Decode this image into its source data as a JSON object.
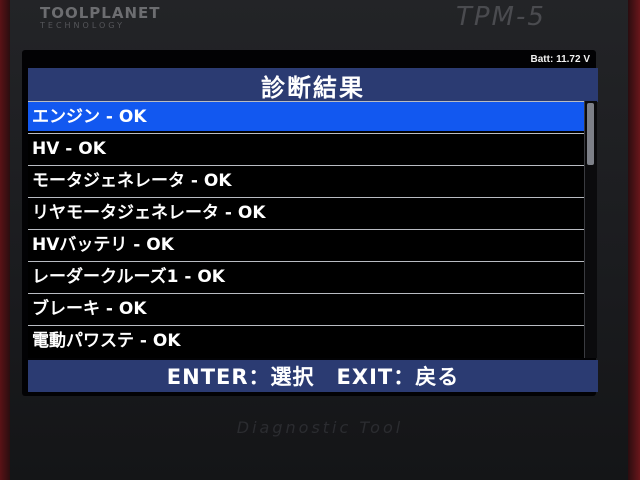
{
  "device": {
    "brand": "TOOLPLANET",
    "brand_sub": "TECHNOLOGY",
    "model": "TPM-5",
    "bottom_label": "Diagnostic Tool"
  },
  "status": {
    "battery": "Batt: 11.72 V"
  },
  "screen": {
    "title": "診断結果",
    "items": [
      {
        "label": "エンジン - OK",
        "selected": true
      },
      {
        "label": "HV - OK",
        "selected": false
      },
      {
        "label": "モータジェネレータ - OK",
        "selected": false
      },
      {
        "label": "リヤモータジェネレータ - OK",
        "selected": false
      },
      {
        "label": "HVバッテリ - OK",
        "selected": false
      },
      {
        "label": "レーダークルーズ1 - OK",
        "selected": false
      },
      {
        "label": "ブレーキ - OK",
        "selected": false
      },
      {
        "label": "電動パワステ - OK",
        "selected": false
      }
    ],
    "footer": "ENTER：選択　EXIT：戻る"
  },
  "colors": {
    "title_bar": "#2b3b72",
    "selected_row": "#1258f0",
    "text": "#ffffff"
  }
}
